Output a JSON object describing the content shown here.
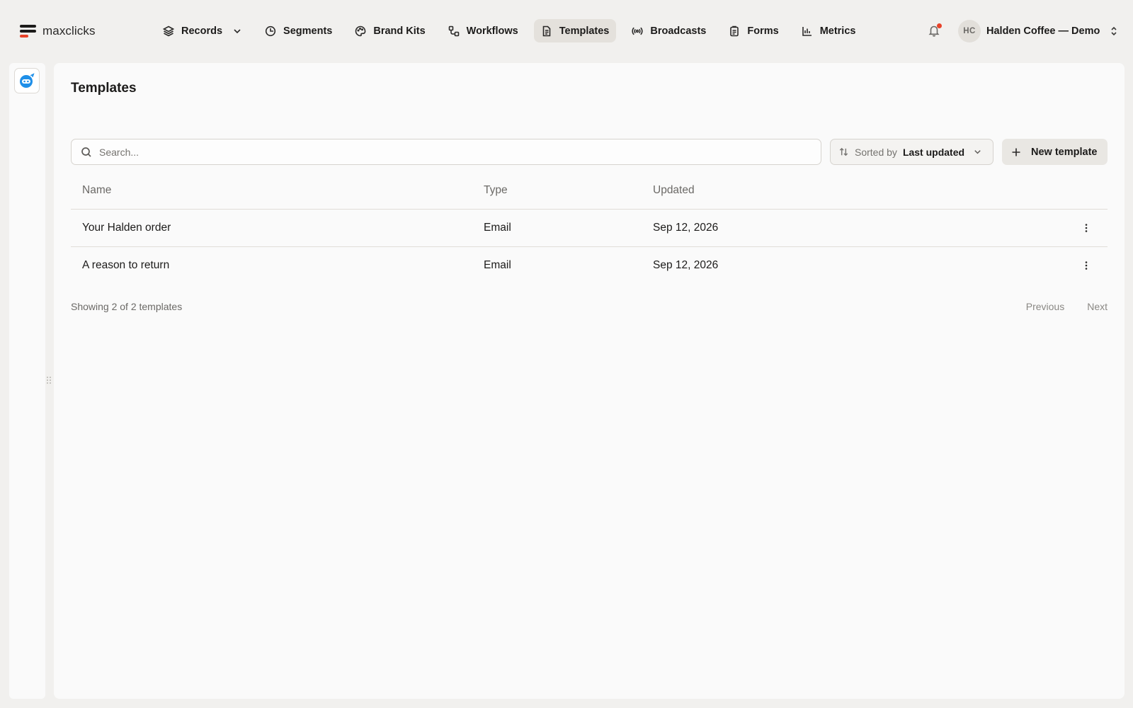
{
  "app": {
    "brand": "maxclicks"
  },
  "nav": {
    "items": [
      {
        "label": "Records",
        "icon": "layers-icon",
        "has_dropdown": true
      },
      {
        "label": "Segments",
        "icon": "segment-pie-icon"
      },
      {
        "label": "Brand Kits",
        "icon": "palette-icon"
      },
      {
        "label": "Workflows",
        "icon": "workflow-icon"
      },
      {
        "label": "Templates",
        "icon": "document-icon",
        "active": true
      },
      {
        "label": "Broadcasts",
        "icon": "broadcast-icon"
      },
      {
        "label": "Forms",
        "icon": "clipboard-icon"
      },
      {
        "label": "Metrics",
        "icon": "bar-chart-icon"
      }
    ]
  },
  "account": {
    "initials": "HC",
    "name": "Halden Coffee — Demo",
    "notification_dot_color": "#e8432a"
  },
  "page": {
    "title": "Templates"
  },
  "toolbar": {
    "search_placeholder": "Search...",
    "sort_prefix": "Sorted by",
    "sort_value": "Last updated",
    "new_button_label": "New template"
  },
  "table": {
    "columns": {
      "name": "Name",
      "type": "Type",
      "updated": "Updated"
    },
    "rows": [
      {
        "name": "Your Halden order",
        "type": "Email",
        "updated": "Sep 12, 2026"
      },
      {
        "name": "A reason to return",
        "type": "Email",
        "updated": "Sep 12, 2026"
      }
    ]
  },
  "footer": {
    "count_text": "Showing 2 of 2 templates",
    "prev_label": "Previous",
    "next_label": "Next"
  },
  "colors": {
    "accent": "#e8432a",
    "active_nav_bg": "#e4e1dc",
    "assistant_blue": "#1f8fe8"
  }
}
